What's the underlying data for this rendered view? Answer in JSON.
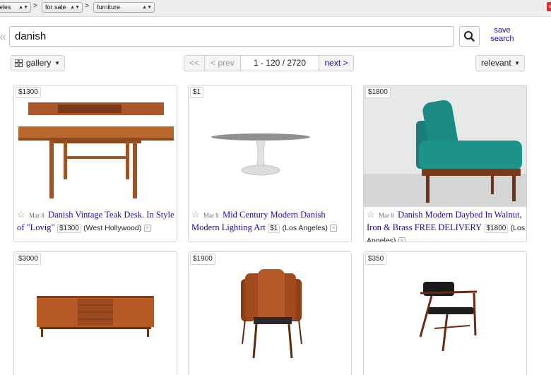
{
  "breadcrumb": {
    "location": "eles",
    "section": "for sale",
    "category": "furniture",
    "separator": ">"
  },
  "search": {
    "query": "danish",
    "save_label_line1": "save",
    "save_label_line2": "search"
  },
  "controls": {
    "view_label": "gallery",
    "sort_label": "relevant"
  },
  "pager": {
    "first": "<<",
    "prev": "< prev",
    "range": "1 - 120 / 2720",
    "next": "next >"
  },
  "listings": [
    {
      "badge": "$1300",
      "date": "Mar 8",
      "title": "Danish Vintage Teak Desk. In Style of \"Lovig\"",
      "price": "$1300",
      "hood": "(West Hollywood)"
    },
    {
      "badge": "$1",
      "date": "Mar 8",
      "title": "Mid Century Modern Danish Modern Lighting Art",
      "price": "$1",
      "hood": "(Los Angeles)"
    },
    {
      "badge": "$1800",
      "date": "Mar 8",
      "title": "Danish Modern Daybed In Walnut, Iron & Brass FREE DELIVERY",
      "price": "$1800",
      "hood": "(Los Angeles)"
    },
    {
      "badge": "$3000"
    },
    {
      "badge": "$1900"
    },
    {
      "badge": "$350"
    }
  ],
  "icons": {
    "star": "star-icon",
    "hide": "hide-listing-icon",
    "search": "magnifier-icon",
    "grid": "grid-icon",
    "collapse": "double-chevron-left-icon"
  },
  "colors": {
    "link": "#1a0dab",
    "border": "#d4d4d4",
    "topbar": "#eeeeee"
  }
}
